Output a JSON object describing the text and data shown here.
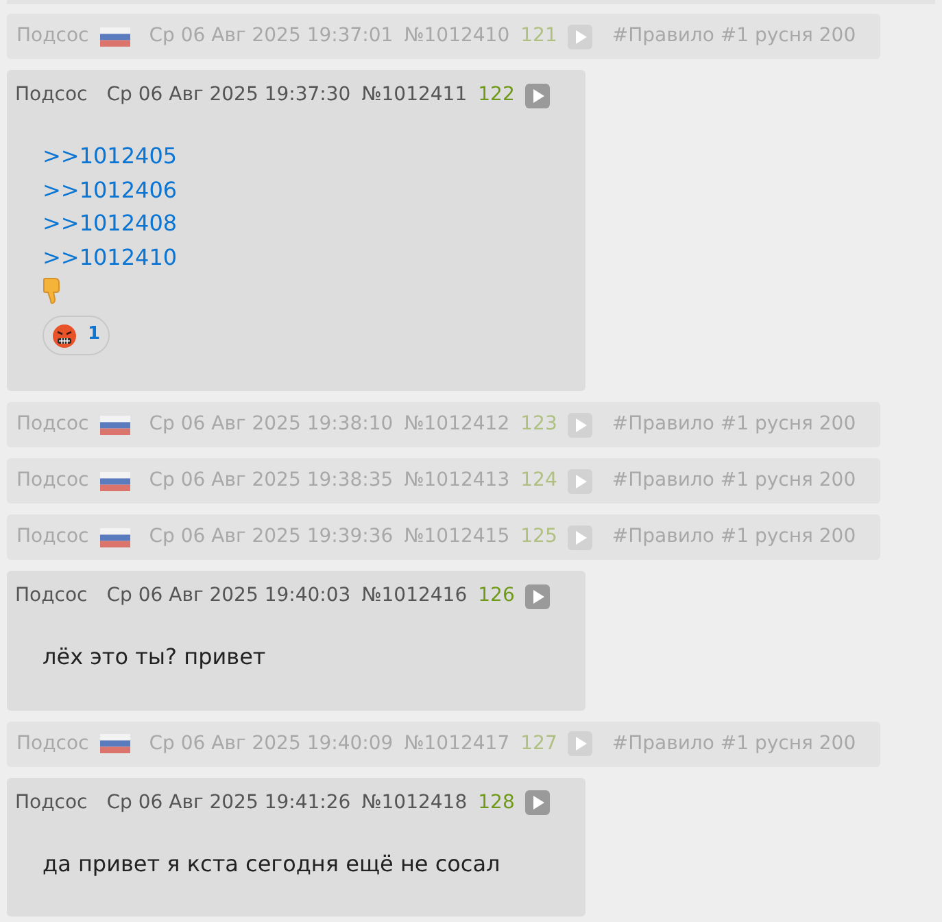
{
  "posts": [
    {
      "hidden": true,
      "name": "Подсос",
      "date": "Ср 06 Авг 2025 19:37:01",
      "number": "№1012410",
      "index": "121",
      "reason": "#Правило #1 русня 200"
    },
    {
      "hidden": false,
      "name": "Подсос",
      "date": "Ср 06 Авг 2025 19:37:30",
      "number": "№1012411",
      "index": "122",
      "body": [
        {
          "kind": "link",
          "text": ">>1012405"
        },
        {
          "kind": "link",
          "text": ">>1012406"
        },
        {
          "kind": "link",
          "text": ">>1012408"
        },
        {
          "kind": "link",
          "text": ">>1012410"
        },
        {
          "kind": "icon"
        }
      ],
      "reactions": [
        {
          "count": "1"
        }
      ]
    },
    {
      "hidden": true,
      "name": "Подсос",
      "date": "Ср 06 Авг 2025 19:38:10",
      "number": "№1012412",
      "index": "123",
      "reason": "#Правило #1 русня 200"
    },
    {
      "hidden": true,
      "name": "Подсос",
      "date": "Ср 06 Авг 2025 19:38:35",
      "number": "№1012413",
      "index": "124",
      "reason": "#Правило #1 русня 200"
    },
    {
      "hidden": true,
      "name": "Подсос",
      "date": "Ср 06 Авг 2025 19:39:36",
      "number": "№1012415",
      "index": "125",
      "reason": "#Правило #1 русня 200"
    },
    {
      "hidden": false,
      "name": "Подсос",
      "date": "Ср 06 Авг 2025 19:40:03",
      "number": "№1012416",
      "index": "126",
      "body": [
        {
          "kind": "text",
          "text": "лёх это ты? привет"
        }
      ]
    },
    {
      "hidden": true,
      "name": "Подсос",
      "date": "Ср 06 Авг 2025 19:40:09",
      "number": "№1012417",
      "index": "127",
      "reason": "#Правило #1 русня 200"
    },
    {
      "hidden": false,
      "name": "Подсос",
      "date": "Ср 06 Авг 2025 19:41:26",
      "number": "№1012418",
      "index": "128",
      "body": [
        {
          "kind": "text",
          "text": "да привет я кста сегодня ещё не сосал"
        }
      ]
    }
  ]
}
